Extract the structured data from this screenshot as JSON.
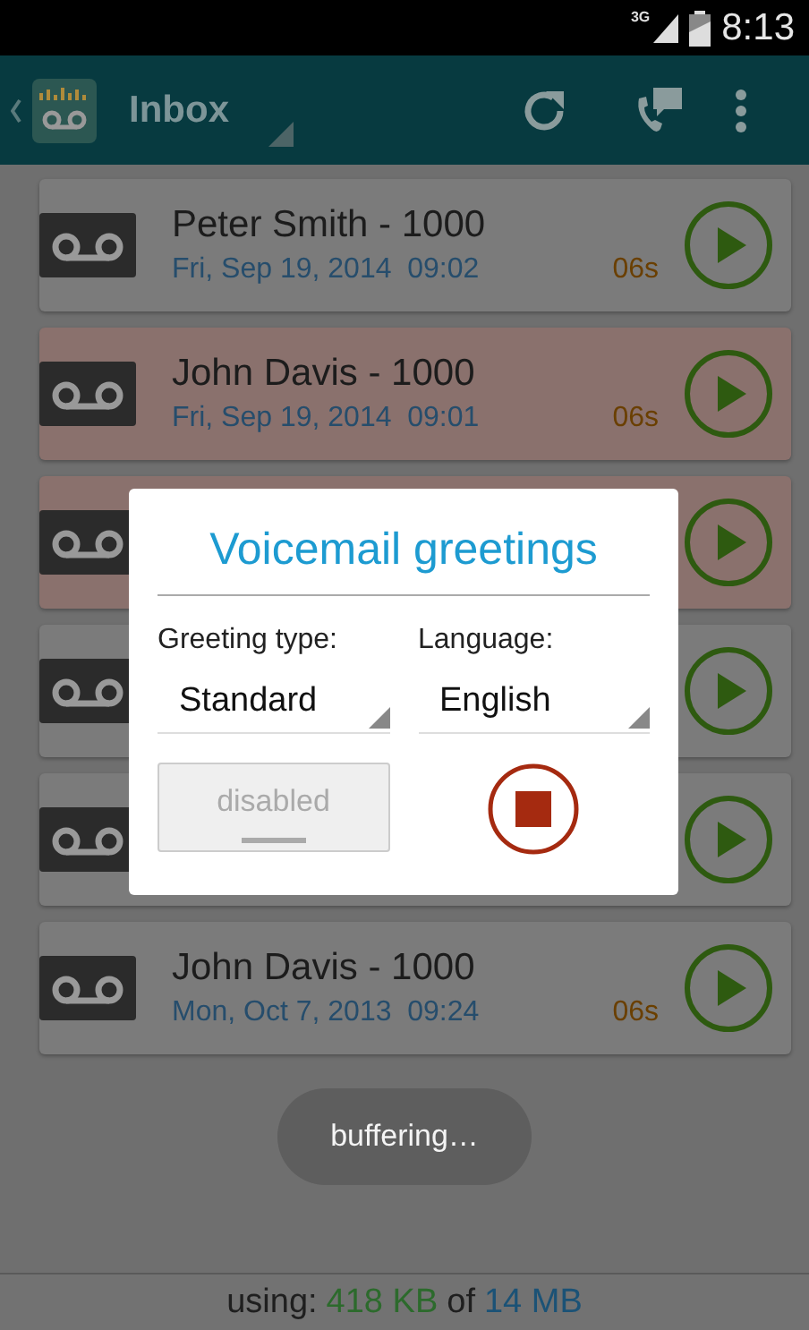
{
  "status_bar": {
    "network": "3G",
    "time": "8:13"
  },
  "action_bar": {
    "title": "Inbox"
  },
  "messages": [
    {
      "name": "Peter Smith - 1000",
      "date": "Fri, Sep 19, 2014  09:02",
      "duration": "06s",
      "unread": false
    },
    {
      "name": "John Davis - 1000",
      "date": "Fri, Sep 19, 2014  09:01",
      "duration": "06s",
      "unread": true
    },
    {
      "unread": true
    },
    {
      "unread": false
    },
    {
      "unread": false
    },
    {
      "name": "John Davis - 1000",
      "date": "Mon, Oct 7, 2013  09:24",
      "duration": "06s",
      "unread": false
    }
  ],
  "dialog": {
    "title": "Voicemail greetings",
    "fields": [
      {
        "label": "Greeting type:",
        "value": "Standard"
      },
      {
        "label": "Language:",
        "value": "English"
      }
    ],
    "record_button": {
      "label": "disabled",
      "disabled": true
    },
    "playback": {
      "playing": true
    }
  },
  "toast": {
    "text": "buffering…"
  },
  "footer": {
    "label": "using:",
    "used": "418 KB",
    "of": "of",
    "total": "14 MB"
  }
}
